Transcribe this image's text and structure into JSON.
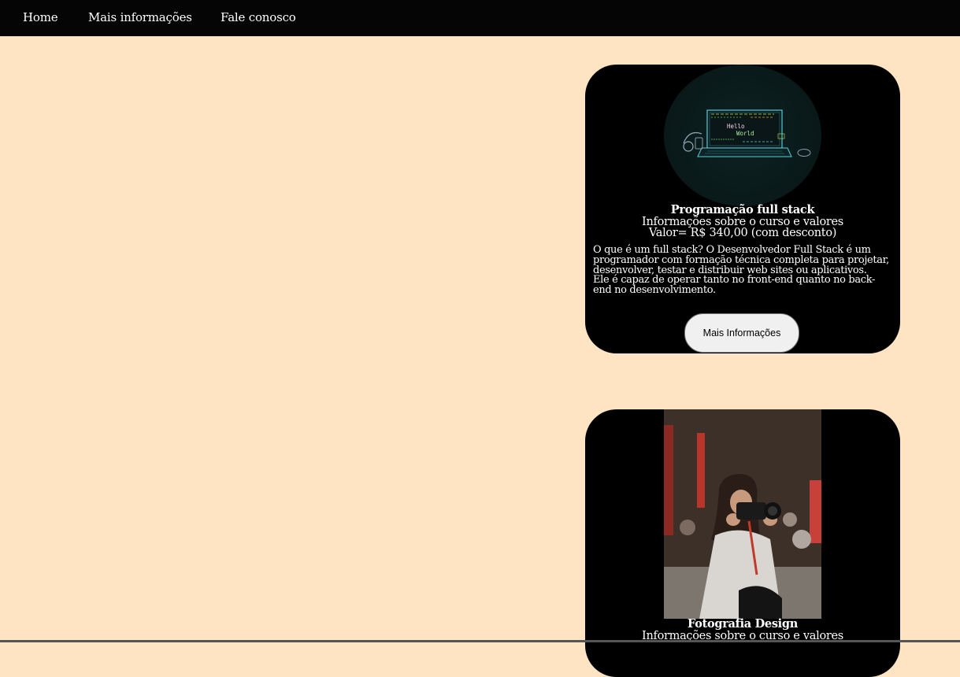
{
  "nav": {
    "items": [
      {
        "label": "Home"
      },
      {
        "label": "Mais informações"
      },
      {
        "label": "Fale conosco"
      }
    ]
  },
  "cards": [
    {
      "image_subject": "laptop showing Hello World",
      "screen_text": "Hello World",
      "title": "Programação full stack",
      "subtitle": "Informações sobre o curso e valores",
      "price": "Valor= R$ 340,00 (com desconto)",
      "description_line1": "O que é um full stack? O Desenvolvedor Full Stack é um programador com formação técnica completa para projetar, desenvolver, testar e distribuir web sites ou aplicativos.",
      "description_line2": "Ele é capaz de operar tanto no front-end quanto no back-end no desenvolvimento.",
      "button_label": "Mais Informações"
    },
    {
      "image_subject": "woman photographing with a camera",
      "title": "Fotografia Design",
      "subtitle": "Informações sobre o curso e valores"
    }
  ],
  "colors": {
    "page_background": "#ffe4c4",
    "nav_background": "#050505",
    "card_background": "#000000",
    "text": "#ffffff",
    "button_background": "#f0f0f0"
  }
}
